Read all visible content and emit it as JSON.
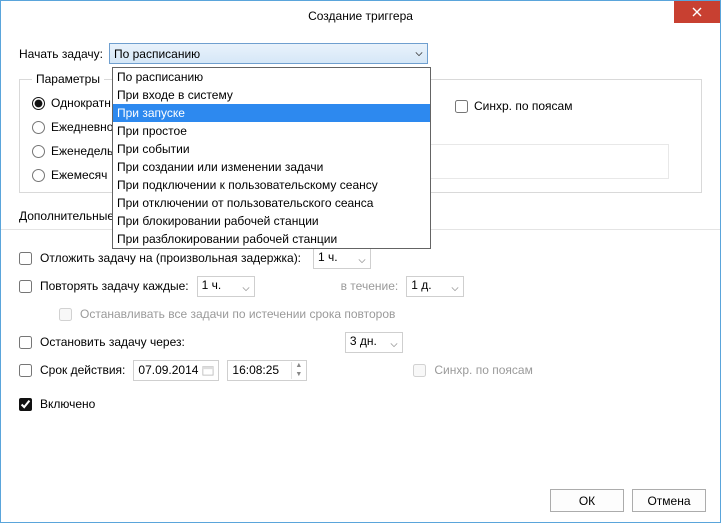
{
  "window": {
    "title": "Создание триггера"
  },
  "begin": {
    "label": "Начать задачу:",
    "selected": "По расписанию",
    "options": [
      "По расписанию",
      "При входе в систему",
      "При запуске",
      "При простое",
      "При событии",
      "При создании или изменении задачи",
      "При подключении к пользовательскому сеансу",
      "При отключении от пользовательского сеанса",
      "При блокировании рабочей станции",
      "При разблокировании рабочей станции"
    ],
    "highlight_index": 2
  },
  "params": {
    "legend": "Параметры",
    "radios": [
      "Однократн",
      "Ежедневно",
      "Еженедель",
      "Ежемесяч"
    ],
    "radio_selected": 0,
    "sync_label": "Синхр. по поясам"
  },
  "additional": {
    "title": "Дополнительные параметры",
    "delay_label": "Отложить задачу на (произвольная задержка):",
    "delay_value": "1 ч.",
    "repeat_label": "Повторять задачу каждые:",
    "repeat_value": "1 ч.",
    "repeat_duration_label": "в течение:",
    "repeat_duration_value": "1 д.",
    "stop_all_label": "Останавливать все задачи по истечении срока повторов",
    "stop_after_label": "Остановить задачу через:",
    "stop_after_value": "3 дн.",
    "expire_label": "Срок действия:",
    "expire_date": "07.09.2014",
    "expire_time": "16:08:25",
    "expire_sync_label": "Синхр. по поясам",
    "enabled_label": "Включено"
  },
  "buttons": {
    "ok": "ОК",
    "cancel": "Отмена"
  }
}
